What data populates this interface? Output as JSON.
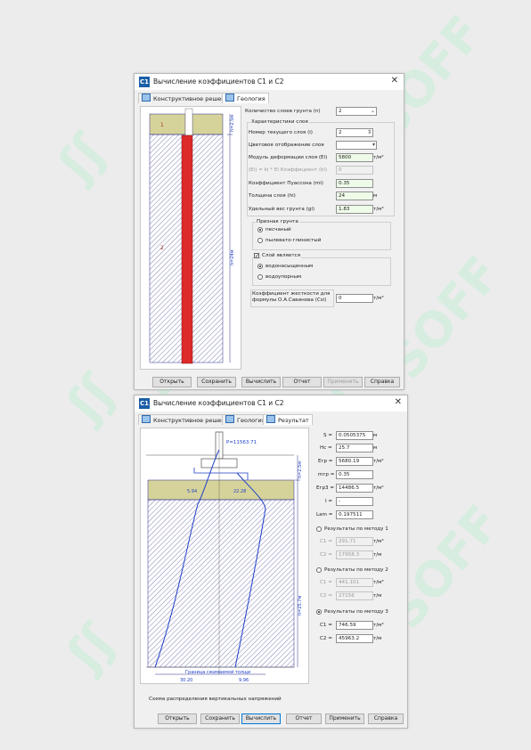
{
  "window1": {
    "title": "Вычисление коэффициентов C1 и C2",
    "tabs": [
      {
        "label": "Конструктивное решение"
      },
      {
        "label": "Геология"
      }
    ],
    "layer_labels": [
      "1",
      "2"
    ],
    "dims": [
      "h=2.5м",
      "h=24м"
    ],
    "form": {
      "layers_count_label": "Количество слоев грунта (n)",
      "layers_count_value": "2",
      "group_title": "Характеристики слоя",
      "layer_num_label": "Номер текущего слоя (i)",
      "layer_num_value": "2",
      "color_label": "Цветовое отображение слоя",
      "modulus_label": "Модуль деформации слоя (Ei)",
      "modulus_value": "5800",
      "modulus_unit": "т/м²",
      "coef_label": "(Ei) = ki * Ei Коэффициент (ki)",
      "coef_value": "0",
      "poisson_label": "Коэффициент Пуассона (mi)",
      "poisson_value": "0.35",
      "thickness_label": "Толщина слоя (hi)",
      "thickness_value": "24",
      "thickness_unit": "м",
      "weight_label": "Удельный вес грунта (gi)",
      "weight_value": "1.83",
      "weight_unit": "т/м³",
      "soil_group_title": "Признак грунта",
      "soil_sandy": "песчаный",
      "soil_clay": "пылевато-глинистый",
      "layer_is_label": "Слой является",
      "water_saturated": "водонасыщенным",
      "water_resistant": "водоупорным",
      "stiffness_label": "Коэффициент жесткости для формулы О.А.Савинова (Csi)",
      "stiffness_value": "0",
      "stiffness_unit": "т/м³"
    },
    "buttons": {
      "open": "Открыть",
      "save": "Сохранить",
      "calc": "Вычислить",
      "report": "Отчет",
      "apply": "Применить",
      "help": "Справка"
    }
  },
  "window2": {
    "title": "Вычисление коэффициентов C1 и C2",
    "tabs": [
      {
        "label": "Конструктивное решение"
      },
      {
        "label": "Геология"
      },
      {
        "label": "Результат"
      }
    ],
    "diagram": {
      "load_label": "P=11563.71",
      "left_value_top": "5.94",
      "right_value_top": "22.28",
      "boundary_label": "Граница сжимаемой толщи",
      "left_value_bottom": "30.20",
      "right_value_bottom": "9.96",
      "dim_top": "h=2.5м",
      "dim_bottom": "h=25.7м",
      "caption": "Схема распределения вертикальных напряжений"
    },
    "results": {
      "S_label": "S =",
      "S_value": "0.0505375",
      "S_unit": "м",
      "Hc_label": "Hc =",
      "Hc_value": "25.7",
      "Hc_unit": "м",
      "Egr_label": "Eгр =",
      "Egr_value": "5680.19",
      "Egr_unit": "т/м²",
      "mgr_label": "mгр =",
      "mgr_value": "0.35",
      "Egr3_label": "Eгр3 =",
      "Egr3_value": "14486.5",
      "Egr3_unit": "т/м²",
      "I_label": "I =",
      "I_value": "-",
      "Lam_label": "Lam =",
      "Lam_value": "0.197511",
      "method1_label": "Результаты по методу 1",
      "m1_c1_label": "C1 =",
      "m1_c1_value": "291.71",
      "m1_c1_unit": "т/м³",
      "m1_c2_label": "C2 =",
      "m1_c2_value": "17958.3",
      "m1_c2_unit": "т/м",
      "method2_label": "Результаты по методу 2",
      "m2_c1_label": "C1 =",
      "m2_c1_value": "441.101",
      "m2_c1_unit": "т/м³",
      "m2_c2_label": "C2 =",
      "m2_c2_value": "27156",
      "m2_c2_unit": "т/м",
      "method3_label": "Результаты по методу 3",
      "m3_c1_label": "C1 =",
      "m3_c1_value": "746.59",
      "m3_c1_unit": "т/м³",
      "m3_c2_label": "C2 =",
      "m3_c2_value": "45963.2",
      "m3_c2_unit": "т/м"
    },
    "buttons": {
      "open": "Открыть",
      "save": "Сохранить",
      "calc": "Вычислить",
      "report": "Отчет",
      "apply": "Применить",
      "help": "Справка"
    }
  },
  "watermark": "SOFF",
  "colors": {
    "pile": "#dd2a2a",
    "layer1": "#d6d39a",
    "hatch": "#2a2a8a",
    "curve": "#1f3fc8",
    "accent": "#0078d7"
  }
}
